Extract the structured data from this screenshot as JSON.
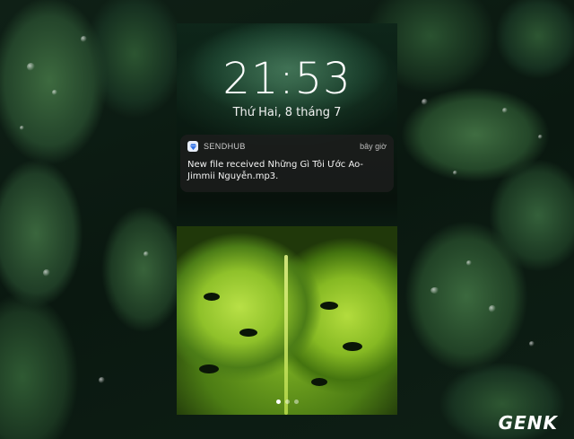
{
  "lockscreen": {
    "time": "21:53",
    "date": "Thứ Hai, 8 tháng 7"
  },
  "notification": {
    "app_name": "SENDHUB",
    "time": "bây giờ",
    "message": "New file received Những Gì Tôi Ước Ao-Jimmii Nguyễn.mp3."
  },
  "pager": {
    "dot_count": 3,
    "active_index": 0
  },
  "watermark": {
    "text": "GENK"
  },
  "colors": {
    "notification_bg": "#1e1e1e",
    "app_icon_accent": "#2f6fe4"
  },
  "icons": {
    "app_icon": "sendhub-diamond-icon"
  }
}
